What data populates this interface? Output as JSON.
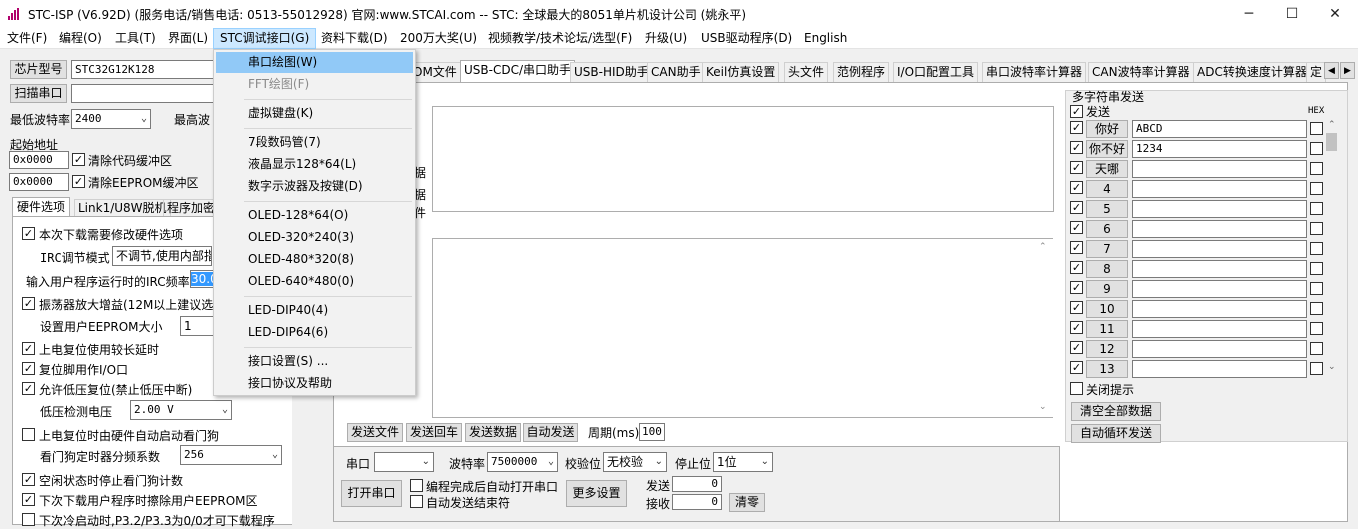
{
  "window": {
    "title": "STC-ISP (V6.92D) (服务电话/销售电话: 0513-55012928) 官网:www.STCAI.com  -- STC: 全球最大的8051单片机设计公司 (姚永平)",
    "controls": [
      "─",
      "☐",
      "✕"
    ]
  },
  "menubar": {
    "items": [
      "文件(F)",
      "编程(O)",
      "工具(T)",
      "界面(L)",
      "STC调试接口(G)",
      "资料下载(D)",
      "200万大奖(U)",
      "视频教学/技术论坛/选型(F)",
      "升级(U)",
      "USB驱动程序(D)",
      "English"
    ]
  },
  "dropdown": {
    "items": [
      "串口绘图(W)",
      "FFT绘图(F)",
      "虚拟键盘(K)",
      "7段数码管(7)",
      "液晶显示128*64(L)",
      "数字示波器及按键(D)",
      "OLED-128*64(O)",
      "OLED-320*240(3)",
      "OLED-480*320(8)",
      "OLED-640*480(0)",
      "LED-DIP40(4)",
      "LED-DIP64(6)",
      "接口设置(S) ...",
      "接口协议及帮助"
    ]
  },
  "left": {
    "chip_label": "芯片型号",
    "chip_value": "STC32G12K128",
    "scan_label": "扫描串口",
    "min_baud_label": "最低波特率",
    "min_baud_value": "2400",
    "max_baud_label": "最高波",
    "start_addr_label": "起始地址",
    "addr1": "0x0000",
    "clear_code": "清除代码缓冲区",
    "addr2": "0x0000",
    "clear_eeprom": "清除EEPROM缓冲区",
    "tabs": [
      "硬件选项",
      "Link1/U8W脱机",
      "程序加密"
    ],
    "opt_modify_hw": "本次下载需要修改硬件选项",
    "irc_mode_label": "IRC调节模式",
    "irc_mode_value": "不调节,使用内部指",
    "irc_freq_label": "输入用户程序运行时的IRC频率",
    "irc_freq_value": "30.0",
    "osc_gain": "振荡器放大增益(12M以上建议选择",
    "eeprom_size_label": "设置用户EEPROM大小",
    "eeprom_size_value": "1",
    "power_reset_delay": "上电复位使用较长延时",
    "reset_pin_io": "复位脚用作I/O口",
    "lvd_reset": "允许低压复位(禁止低压中断)",
    "lvd_voltage_label": "低压检测电压",
    "lvd_voltage_value": "2.00 V",
    "wdt_auto": "上电复位时由硬件自动启动看门狗",
    "wdt_div_label": "看门狗定时器分频系数",
    "wdt_div_value": "256",
    "idle_stop_wdt": "空闲状态时停止看门狗计数",
    "erase_eeprom": "下次下载用户程序时擦除用户EEPROM区",
    "next_boot": "下次冷启动时,P3.2/P3.3为0/0才可下载程序"
  },
  "tabs": [
    "OM文件",
    "USB-CDC/串口助手",
    "USB-HID助手",
    "CAN助手",
    "Keil仿真设置",
    "头文件",
    "范例程序",
    "I/O口配置工具",
    "串口波特率计算器",
    "CAN波特率计算器",
    "ADC转换速度计算器",
    "定"
  ],
  "serial": {
    "partial_labels": [
      "据",
      "据",
      "件"
    ],
    "send_file": "发送文件",
    "send_cr": "发送回车",
    "send_data": "发送数据",
    "auto_send": "自动发送",
    "period_label": "周期(ms)",
    "period_value": "100",
    "port_label": "串口",
    "baud_label": "波特率",
    "baud_value": "7500000",
    "parity_label": "校验位",
    "parity_value": "无校验",
    "stop_label": "停止位",
    "stop_value": "1位",
    "open_port": "打开串口",
    "auto_open": "编程完成后自动打开串口",
    "auto_send_end": "自动发送结束符",
    "more_settings": "更多设置",
    "send_label": "发送",
    "send_count": "0",
    "recv_label": "接收",
    "recv_count": "0",
    "clear": "清零"
  },
  "multi": {
    "title": "多字符串发送",
    "send_header": "发送",
    "hex_header": "HEX",
    "rows": [
      {
        "label": "你好",
        "value": "ABCD"
      },
      {
        "label": "你不好",
        "value": "1234"
      },
      {
        "label": "天哪",
        "value": ""
      },
      {
        "label": "4",
        "value": ""
      },
      {
        "label": "5",
        "value": ""
      },
      {
        "label": "6",
        "value": ""
      },
      {
        "label": "7",
        "value": ""
      },
      {
        "label": "8",
        "value": ""
      },
      {
        "label": "9",
        "value": ""
      },
      {
        "label": "10",
        "value": ""
      },
      {
        "label": "11",
        "value": ""
      },
      {
        "label": "12",
        "value": ""
      },
      {
        "label": "13",
        "value": ""
      }
    ],
    "close_tip": "关闭提示",
    "clear_all": "清空全部数据",
    "auto_loop": "自动循环发送"
  }
}
